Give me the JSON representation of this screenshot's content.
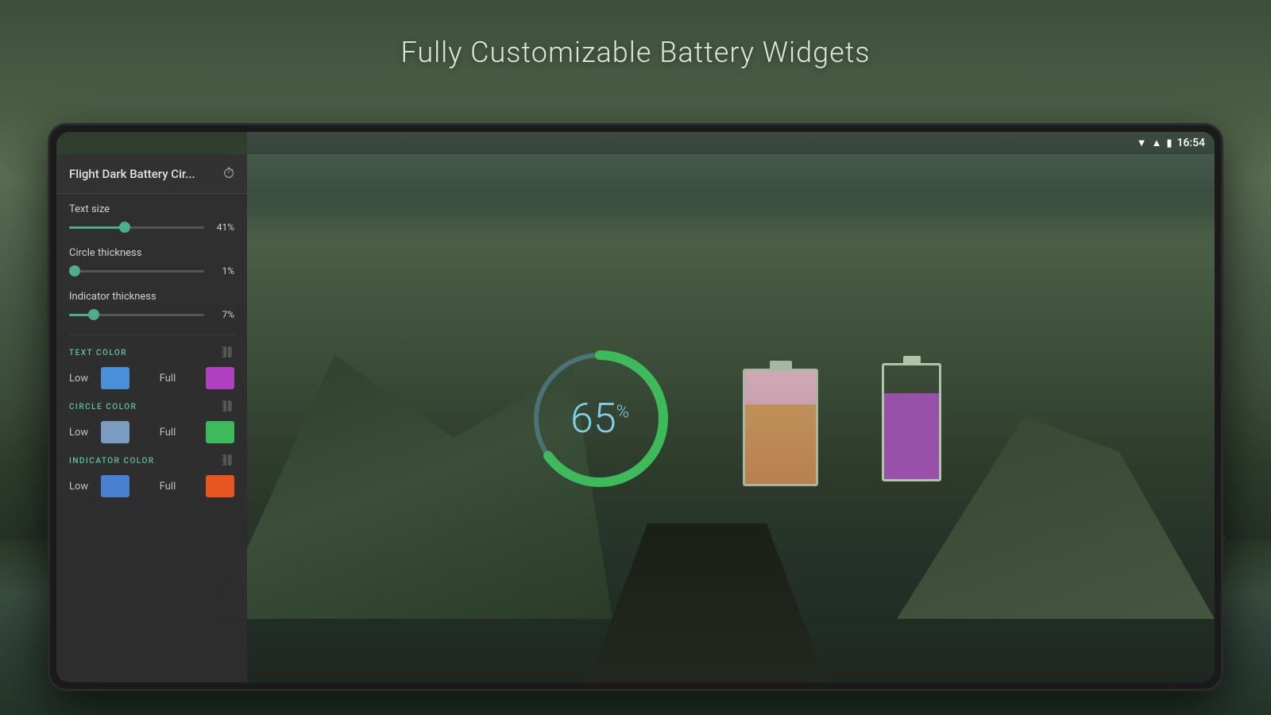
{
  "page": {
    "title": "Fully Customizable Battery Widgets"
  },
  "background": {
    "gradient_desc": "dark mountain landscape with road"
  },
  "tablet": {
    "status_bar": {
      "wifi_icon": "▼",
      "signal_icon": "▲",
      "battery_icon": "🔋",
      "time": "16:54"
    },
    "panel": {
      "title": "Flight Dark Battery Cir...",
      "history_icon": "⏱",
      "sliders": [
        {
          "label": "Text size",
          "value": 41,
          "display": "41%",
          "fill_pct": 41
        },
        {
          "label": "Circle thickness",
          "value": 1,
          "display": "1%",
          "fill_pct": 4
        },
        {
          "label": "Indicator thickness",
          "value": 7,
          "display": "7%",
          "fill_pct": 18
        }
      ],
      "color_sections": [
        {
          "title": "TEXT COLOR",
          "link_icon": "🔗",
          "low_label": "Low",
          "low_color": "#4a90d9",
          "full_label": "Full",
          "full_color": "#b040c0"
        },
        {
          "title": "CIRCLE COLOR",
          "link_icon": "🔗",
          "low_label": "Low",
          "low_color": "#7a9cc0",
          "full_label": "Full",
          "full_color": "#3dba5a"
        },
        {
          "title": "INDICATOR COLOR",
          "link_icon": "🔗",
          "low_label": "Low",
          "low_color": "#4a80d0",
          "full_label": "Full",
          "full_color": "#e85520"
        }
      ]
    },
    "circle_widget": {
      "percentage": "65",
      "suffix": "%",
      "arc_background_color": "#5a9ab5",
      "arc_fill_color": "#3dba5a",
      "arc_fill_pct": 65
    },
    "battery_classic": {
      "fill_pct": 65,
      "fill_color_top": "#c8a0b0",
      "fill_color_bottom": "#c0905a"
    },
    "battery_block": {
      "fill_pct": 65,
      "fill_color": "#9850a8",
      "border_color": "#b8ceb0"
    }
  }
}
